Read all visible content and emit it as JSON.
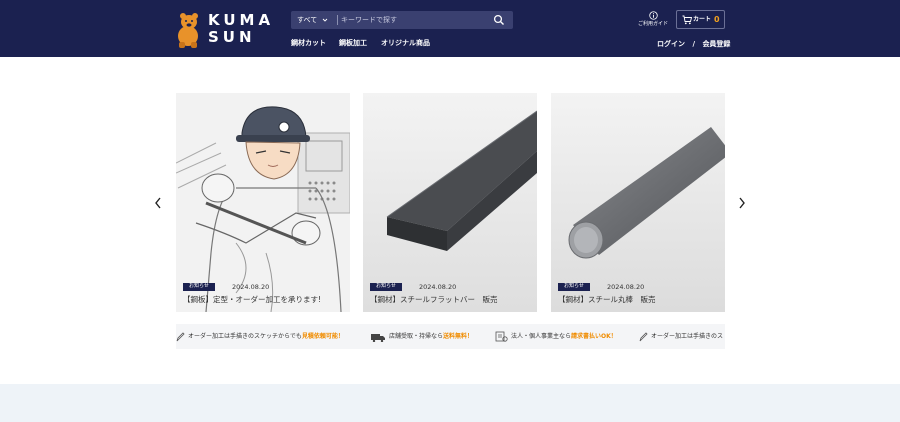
{
  "header": {
    "logo_line1": "KUMA",
    "logo_line2": "SUN",
    "search": {
      "category": "すべて",
      "placeholder": "キーワードで探す"
    },
    "nav": [
      {
        "label": "鋼材カット"
      },
      {
        "label": "鋼板加工"
      },
      {
        "label": "オリジナル商品"
      }
    ],
    "guide_label": "ご利用ガイド",
    "cart_label": "カート",
    "cart_count": "0",
    "login_label": "ログイン",
    "separator": "/",
    "register_label": "会員登録"
  },
  "cards": [
    {
      "tag": "お知らせ",
      "date": "2024.08.20",
      "title": "【鋼板】定型・オーダー加工を承ります!"
    },
    {
      "tag": "お知らせ",
      "date": "2024.08.20",
      "title": "【鋼材】スチールフラットバー　販売"
    },
    {
      "tag": "お知らせ",
      "date": "2024.08.20",
      "title": "【鋼材】スチール丸棒　販売"
    }
  ],
  "ticker": [
    {
      "text": "オーダー加工は手描きのスケッチからでも",
      "highlight": "見積依頼可能！",
      "icon": "pencil-icon"
    },
    {
      "text": "店舗受取・持帰なら",
      "highlight": "送料無料！",
      "icon": "truck-icon"
    },
    {
      "text": "法人・個人事業主なら",
      "highlight": "請求書払いOK！",
      "icon": "invoice-icon"
    },
    {
      "text": "オーダー加工は手描きのス",
      "highlight": "",
      "icon": "pencil-icon"
    }
  ],
  "colors": {
    "header_bg": "#1b2150",
    "accent": "#f08c00",
    "cart_count": "#f0a020"
  }
}
